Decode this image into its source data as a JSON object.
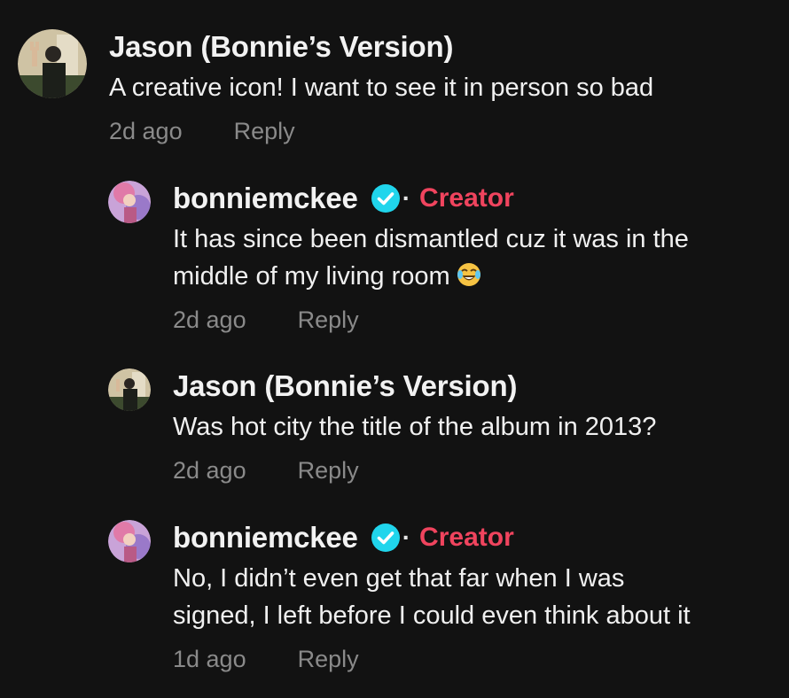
{
  "comments": [
    {
      "author": "Jason (Bonnie’s Version)",
      "text_lines": [
        "A creative icon! I want to see it in person so bad"
      ],
      "time": "2d ago",
      "reply_label": "Reply",
      "verified": false
    },
    {
      "author": "bonniemckee",
      "badge": "Creator",
      "text_lines": [
        "It has since been dismantled cuz it was in the",
        "middle of my living room"
      ],
      "time": "2d ago",
      "reply_label": "Reply",
      "verified": true,
      "emoji": "face-with-tears-of-joy-icon"
    },
    {
      "author": "Jason (Bonnie’s Version)",
      "text_lines": [
        "Was hot city the title of the album in 2013?"
      ],
      "time": "2d ago",
      "reply_label": "Reply",
      "verified": false
    },
    {
      "author": "bonniemckee",
      "badge": "Creator",
      "text_lines": [
        "No, I didn’t even get that far when I was",
        "signed, I left before I could even think about it"
      ],
      "time": "1d ago",
      "reply_label": "Reply",
      "verified": true
    }
  ],
  "colors": {
    "background": "#121212",
    "creator_badge": "#f0445e",
    "verified_badge": "#20d5ec",
    "meta_text": "#8a8a8a"
  }
}
